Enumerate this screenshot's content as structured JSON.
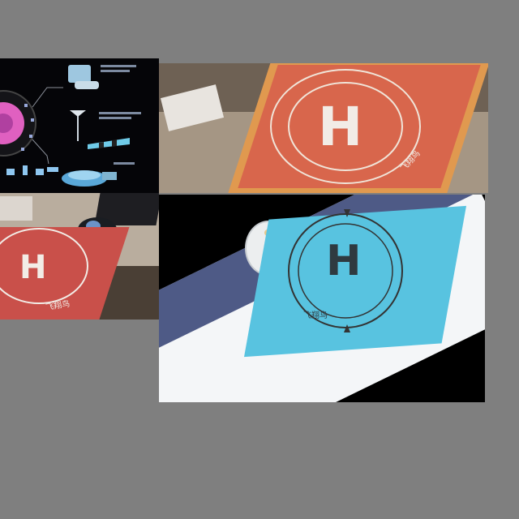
{
  "image": {
    "panels": [
      {
        "id": "infographic",
        "content": "dark diagram with drone landing pad icons and a pink-ringed wheel"
      },
      {
        "id": "orange-pad",
        "content": "orange/red helipad mat with white H on a table"
      },
      {
        "id": "red-pad-desk",
        "content": "red helipad mat on a desk next to a trackball mouse and keyboard"
      },
      {
        "id": "blue-pad",
        "content": "light blue helipad mat with dark H, overexposed frame"
      }
    ],
    "letter": "H",
    "brand_mark": "飞翔鸟"
  },
  "colors": {
    "background": "#7f7f7f",
    "orange_pad": "#d8664c",
    "orange_pad_border": "#e0994f",
    "red_pad": "#c9504a",
    "blue_pad": "#58c3e0",
    "pink_ring": "#e060c0"
  }
}
